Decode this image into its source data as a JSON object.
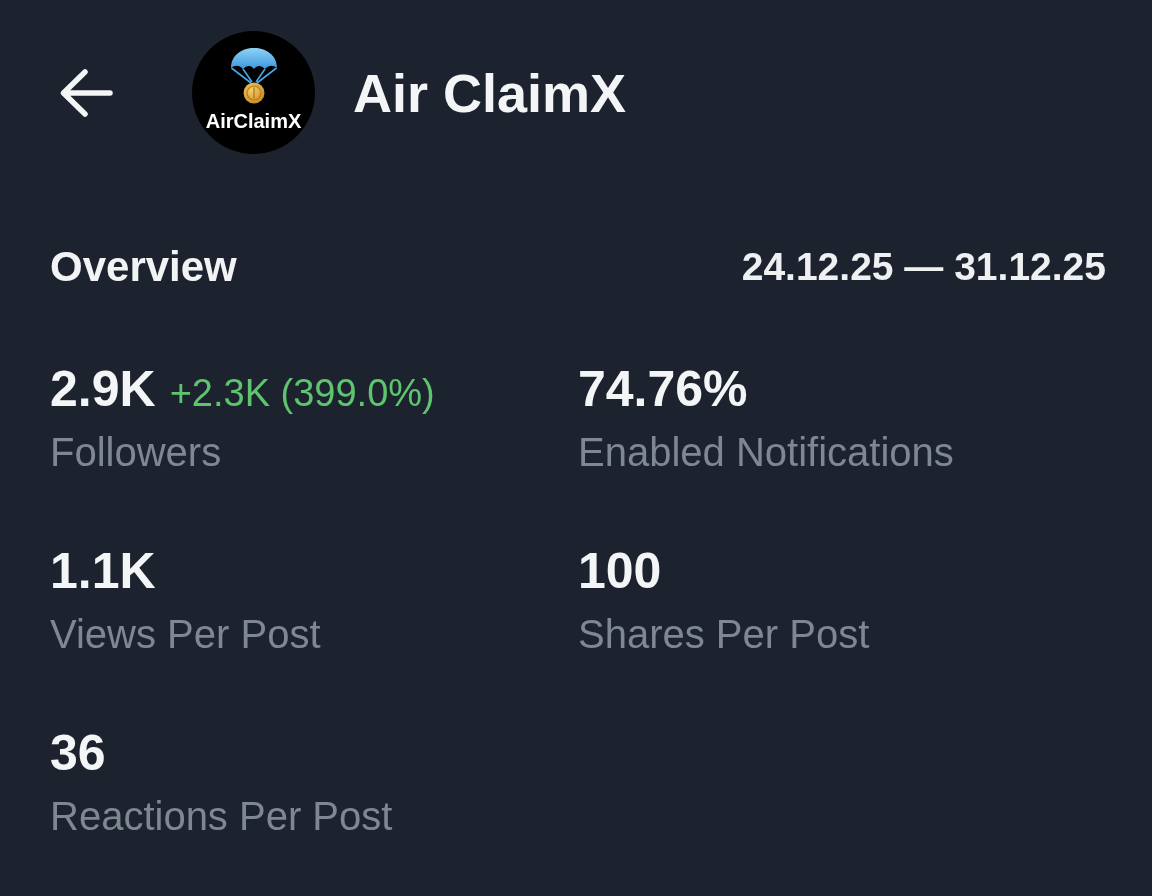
{
  "header": {
    "title": "Air ClaimX",
    "avatar": {
      "caption": "AirClaimX"
    }
  },
  "overview": {
    "title": "Overview",
    "date_range": "24.12.25 — 31.12.25"
  },
  "stats": [
    {
      "value": "2.9K",
      "change": "+2.3K (399.0%)",
      "positive": true,
      "label": "Followers"
    },
    {
      "value": "74.76%",
      "label": "Enabled Notifications"
    },
    {
      "value": "1.1K",
      "label": "Views Per Post"
    },
    {
      "value": "100",
      "label": "Shares Per Post"
    },
    {
      "value": "36",
      "label": "Reactions Per Post"
    }
  ]
}
